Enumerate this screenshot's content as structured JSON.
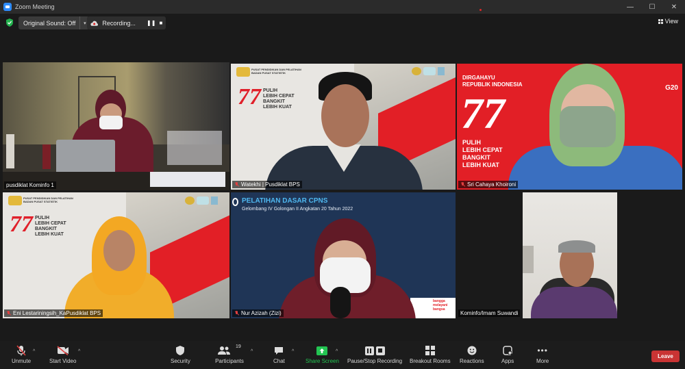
{
  "window": {
    "title": "Zoom Meeting",
    "controls": [
      "—",
      "☐",
      "✕"
    ]
  },
  "topbar": {
    "original_sound": "Original Sound: Off",
    "recording": "Recording...",
    "view": "View"
  },
  "tiles": [
    {
      "name": "pusdiklat Kominfo 1",
      "muted": false,
      "speaking": true
    },
    {
      "name": "Watekhi | Pusdiklat BPS",
      "muted": true
    },
    {
      "name": "Sri Cahaya Khoironi",
      "muted": true
    },
    {
      "name": "Eni Lestariningsih_KaPusdiklat BPS",
      "muted": true
    },
    {
      "name": "Nur Azizah (Zizi)",
      "muted": true
    },
    {
      "name": "Kominfo/Imam Suwandi",
      "muted": false
    }
  ],
  "banners": {
    "bps_org_line1": "PUSAT PENDIDIKAN DAN PELATIHAN",
    "bps_org_line2": "BADAN PUSAT STATISTIK",
    "logo77": "77",
    "slogan": [
      "PULIH",
      "LEBIH CEPAT",
      "BANGKIT",
      "LEBIH KUAT"
    ],
    "dirgahayu_line1": "DIRGAHAYU",
    "dirgahayu_line2": "REPUBLIK INDONESIA",
    "g20": "G20",
    "cpns_title": "PELATIHAN DASAR CPNS",
    "cpns_subtitle": "Gelombang IV Golongan II Angkatan 20 Tahun 2022",
    "bangga": "bangga melayani bangsa"
  },
  "toolbar": {
    "unmute": "Unmute",
    "start_video": "Start Video",
    "security": "Security",
    "participants": "Participants",
    "participants_count": "19",
    "chat": "Chat",
    "share_screen": "Share Screen",
    "pause_stop_recording": "Pause/Stop Recording",
    "breakout_rooms": "Breakout Rooms",
    "reactions": "Reactions",
    "apps": "Apps",
    "more": "More",
    "leave": "Leave"
  },
  "colors": {
    "speaking_border": "#c8e64a",
    "leave": "#c93434",
    "share_green": "#23c552",
    "brand_red": "#e21f26"
  }
}
